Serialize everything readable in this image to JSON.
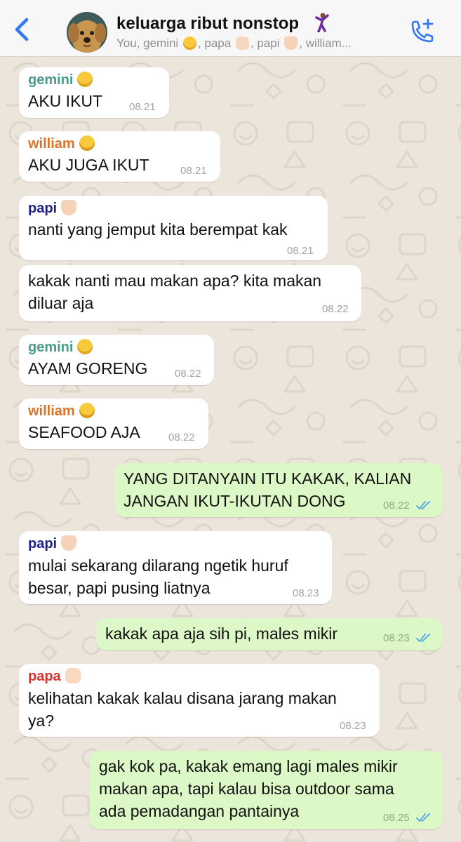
{
  "header": {
    "group_name": "keluarga ribut nonstop",
    "title_emoji_icon": "man-dancing-icon",
    "members": {
      "p1": "You, gemini ",
      "p2": ", papa ",
      "p3": ", papi ",
      "p4": ", william..."
    }
  },
  "colors": {
    "accent": "#3478f6",
    "incoming_bubble": "#ffffff",
    "outgoing_bubble": "#dcf8c6",
    "wallpaper": "#ece5dc",
    "sender_gemini": "#4a9a8a",
    "sender_william": "#d9752a",
    "sender_papi": "#1f1f8c",
    "sender_papa": "#d9302c"
  },
  "messages": [
    {
      "direction": "in",
      "sender": "gemini",
      "sender_icon": "grinning-face-icon",
      "text": "AKU IKUT",
      "time": "08.21"
    },
    {
      "direction": "in",
      "sender": "william",
      "sender_icon": "sleepy-face-icon",
      "text": "AKU JUGA IKUT",
      "time": "08.21"
    },
    {
      "direction": "in",
      "sender": "papi",
      "sender_icon": "heart-hands-icon",
      "text": "nanti yang jemput kita berempat kak",
      "time": "08.21"
    },
    {
      "direction": "in",
      "text": "kakak nanti mau makan apa? kita makan\ndiluar aja",
      "time": "08.22"
    },
    {
      "direction": "in",
      "sender": "gemini",
      "sender_icon": "grinning-face-icon",
      "text": "AYAM GORENG",
      "time": "08.22"
    },
    {
      "direction": "in",
      "sender": "william",
      "sender_icon": "sleepy-face-icon",
      "text": "SEAFOOD AJA",
      "time": "08.22"
    },
    {
      "direction": "out",
      "text": "YANG DITANYAIN ITU KAKAK, KALIAN\nJANGAN IKUT-IKUTAN DONG",
      "time": "08.22",
      "status": "read"
    },
    {
      "direction": "in",
      "sender": "papi",
      "sender_icon": "heart-hands-icon",
      "text": "mulai sekarang dilarang ngetik huruf\nbesar, papi pusing liatnya",
      "time": "08.23"
    },
    {
      "direction": "out",
      "text": "kakak apa aja sih pi, males mikir",
      "time": "08.23",
      "status": "read"
    },
    {
      "direction": "in",
      "sender": "papa",
      "sender_icon": "raised-fist-icon",
      "text": "kelihatan kakak kalau disana jarang makan\nya?",
      "time": "08.23"
    },
    {
      "direction": "out",
      "text": "gak kok pa, kakak emang lagi males mikir\nmakan apa, tapi kalau bisa outdoor sama\nada pemadangan pantainya",
      "time": "08.25",
      "status": "read"
    }
  ]
}
